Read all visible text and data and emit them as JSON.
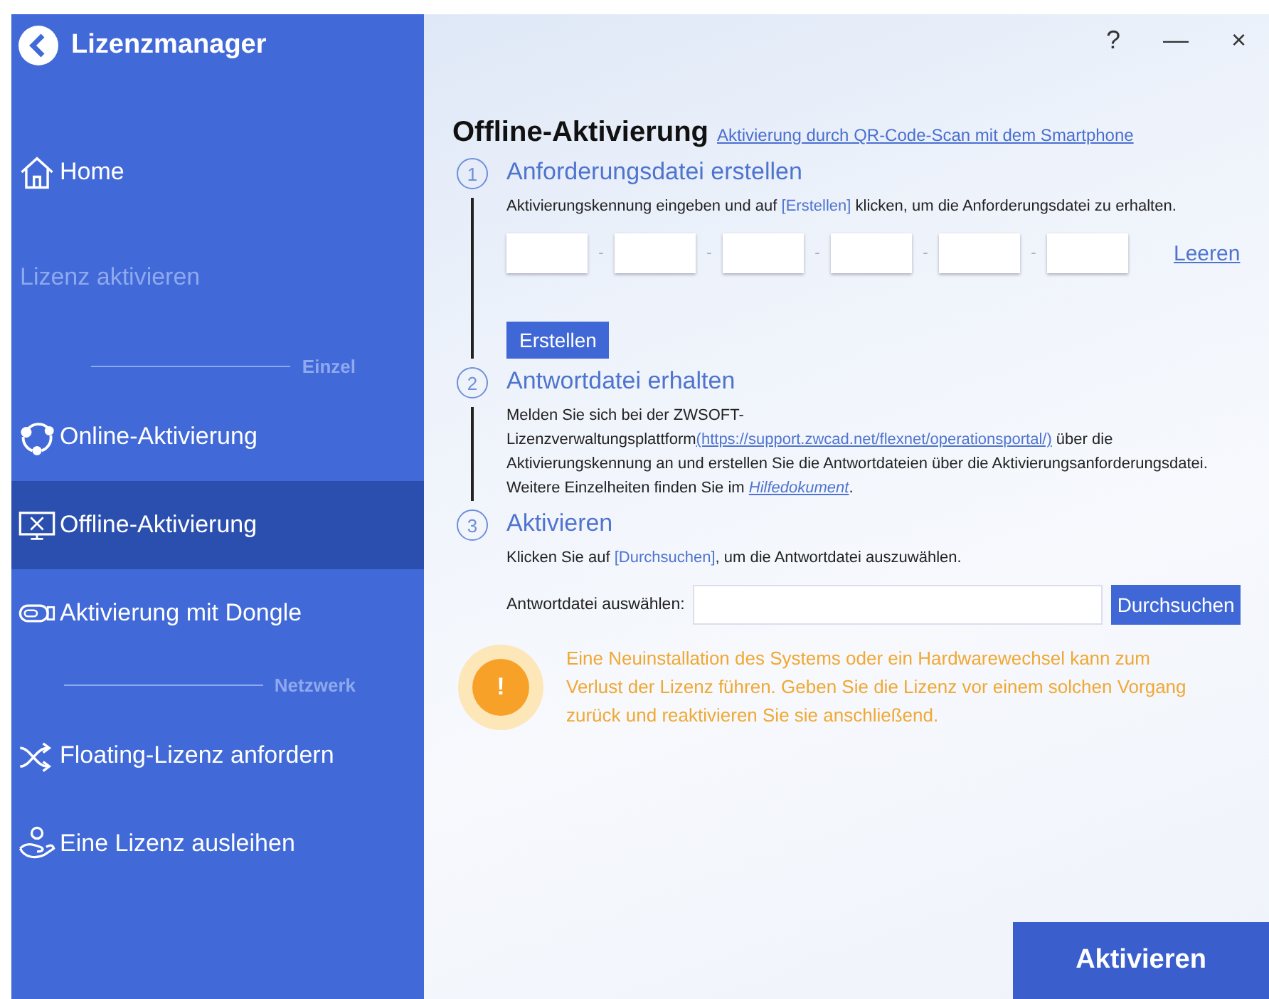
{
  "window": {
    "title": "Lizenzmanager",
    "controls": [
      "?",
      "—",
      "×"
    ]
  },
  "sidebar": {
    "items": [
      {
        "kind": "nav",
        "label": "Home",
        "selected": false
      },
      {
        "kind": "section",
        "label": "Lizenz aktivieren"
      },
      {
        "kind": "divider",
        "label": "Einzel"
      },
      {
        "kind": "nav",
        "label": "Online-Aktivierung",
        "selected": false
      },
      {
        "kind": "nav",
        "label": "Offline-Aktivierung",
        "selected": true
      },
      {
        "kind": "nav",
        "label": "Aktivierung mit Dongle",
        "selected": false
      },
      {
        "kind": "divider",
        "label": "Netzwerk"
      },
      {
        "kind": "nav",
        "label": "Floating-Lizenz anfordern",
        "selected": false
      },
      {
        "kind": "nav",
        "label": "Eine Lizenz ausleihen",
        "selected": false
      }
    ]
  },
  "heading": "Offline-Aktivierung",
  "qr_link": "Aktivierung durch QR-Code-Scan mit dem Smartphone",
  "steps": [
    {
      "number": "1",
      "title": "Anforderungsdatei erstellen",
      "text": [
        {
          "kind": "plain",
          "text": "Aktivierungskennung eingeben und auf "
        },
        {
          "kind": "accent",
          "text": "[Erstellen]"
        },
        {
          "kind": "plain",
          "text": " klicken, um die Anforderungsdatei zu erhalten."
        }
      ]
    },
    {
      "number": "2",
      "title": "Antwortdatei erhalten",
      "text": [
        {
          "kind": "plain",
          "text": "Melden Sie sich bei der ZWSOFT-Lizenzverwaltungsplattform"
        },
        {
          "kind": "link",
          "text": "(https://support.zwcad.net/flexnet/operationsportal/)"
        },
        {
          "kind": "plain",
          "text": " über die Aktivierungskennung an und erstellen Sie die Antwortdateien über die Aktivierungsanforderungsdatei. Weitere Einzelheiten finden Sie im "
        },
        {
          "kind": "italic-link",
          "text": "Hilfedokument"
        },
        {
          "kind": "plain",
          "text": "."
        }
      ]
    },
    {
      "number": "3",
      "title": "Aktivieren",
      "text": [
        {
          "kind": "plain",
          "text": "Klicken Sie auf "
        },
        {
          "kind": "accent",
          "text": "[Durchsuchen]"
        },
        {
          "kind": "plain",
          "text": ", um die Antwortdatei auszuwählen."
        }
      ]
    }
  ],
  "code_fields": {
    "separators": [
      "-",
      "-",
      "-",
      "-",
      "-"
    ],
    "clear": "Leeren"
  },
  "create_button": "Erstellen",
  "file_field": {
    "label": "Antwortdatei auswählen:",
    "button": "Durchsuchen"
  },
  "warning": "Eine Neuinstallation des Systems oder ein Hardwarewechsel kann zum Verlust der Lizenz führen. Geben Sie die Lizenz vor einem solchen Vorgang zurück und reaktivieren Sie sie anschließend.",
  "warning_icon": "!",
  "activate_button": "Aktivieren"
}
